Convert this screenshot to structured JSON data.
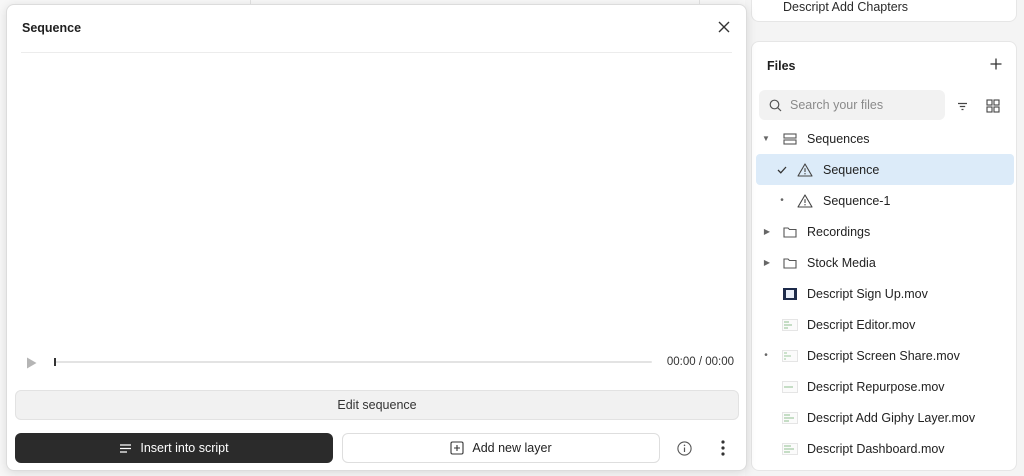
{
  "background": {
    "top_right_card_label": "Descript Add Chapters"
  },
  "modal": {
    "title": "Sequence",
    "timecode": "00:00 / 00:00",
    "edit_sequence_label": "Edit sequence",
    "insert_label": "Insert into script",
    "add_layer_label": "Add new layer",
    "playback_progress": 0
  },
  "files": {
    "title": "Files",
    "search_placeholder": "Search your files",
    "items": [
      {
        "label": "Sequences",
        "lead": "caret-down",
        "icon": "sequences-icon",
        "level": 0
      },
      {
        "label": "Sequence",
        "lead": "check",
        "icon": "warning-icon",
        "level": 1,
        "selected": true
      },
      {
        "label": "Sequence-1",
        "lead": "dot",
        "icon": "warning-icon",
        "level": 1
      },
      {
        "label": "Recordings",
        "lead": "caret-right",
        "icon": "folder-icon",
        "level": 0
      },
      {
        "label": "Stock Media",
        "lead": "caret-right",
        "icon": "folder-icon",
        "level": 0
      },
      {
        "label": "Descript Sign Up.mov",
        "lead": "",
        "icon": "video-thumb-dark",
        "level": 0
      },
      {
        "label": "Descript Editor.mov",
        "lead": "",
        "icon": "video-thumb-light",
        "level": 0
      },
      {
        "label": "Descript Screen Share.mov",
        "lead": "dot",
        "icon": "video-thumb-light",
        "level": 0
      },
      {
        "label": "Descript Repurpose.mov",
        "lead": "",
        "icon": "video-thumb-light",
        "level": 0
      },
      {
        "label": "Descript Add Giphy Layer.mov",
        "lead": "",
        "icon": "video-thumb-light",
        "level": 0
      },
      {
        "label": "Descript Dashboard.mov",
        "lead": "",
        "icon": "video-thumb-light",
        "level": 0
      }
    ]
  },
  "colors": {
    "selected_row": "#dcebf9",
    "primary_button": "#2b2b2b",
    "warning_icon": "#444444"
  }
}
